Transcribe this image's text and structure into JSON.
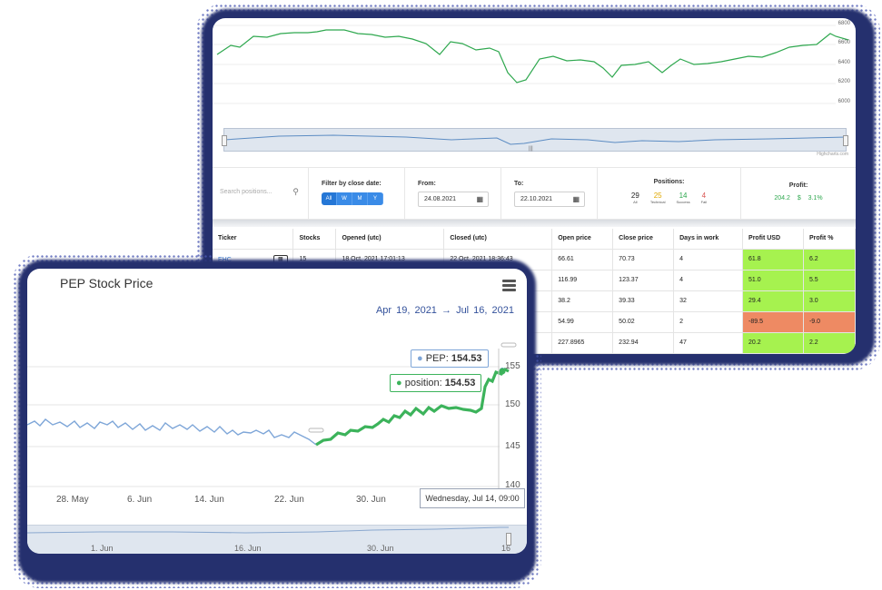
{
  "back_chart": {
    "y_ticks": [
      "6800",
      "6600",
      "6400",
      "6200",
      "6000"
    ],
    "credit": "Highcharts.com",
    "navigator_mid_label": "|||",
    "line_color": "#2fa84f"
  },
  "filters": {
    "search_placeholder": "Search positions...",
    "close_date_label": "Filter by close date:",
    "periods": [
      "All",
      "W",
      "M",
      "Y"
    ],
    "from_label": "From:",
    "from_value": "24.08.2021",
    "to_label": "To:",
    "to_value": "22.10.2021"
  },
  "positions": {
    "title": "Positions:",
    "items": [
      {
        "count": "29",
        "label": "All",
        "color": "#222222"
      },
      {
        "count": "25",
        "label": "Technical",
        "color": "#e0a800"
      },
      {
        "count": "14",
        "label": "Success",
        "color": "#2fa84f"
      },
      {
        "count": "4",
        "label": "Fail",
        "color": "#d9534f"
      }
    ]
  },
  "profit": {
    "title": "Profit:",
    "usd": "204.2 $",
    "pct": "3.1%"
  },
  "table": {
    "headers": [
      "Ticker",
      "Stocks",
      "Opened (utc)",
      "Closed (utc)",
      "Open price",
      "Close price",
      "Days in work",
      "Profit USD",
      "Profit %"
    ],
    "rows": [
      {
        "ticker": "EHC",
        "stocks": "15",
        "opened": "18 Oct, 2021 17:01:13",
        "closed": "22 Oct, 2021 18:36:43",
        "open": "66.61",
        "close": "70.73",
        "days": "4",
        "usd": "61.8",
        "pct": "6.2",
        "status": "g"
      },
      {
        "ticker": "",
        "stocks": "",
        "opened": "",
        "closed": "",
        "open": "116.99",
        "close": "123.37",
        "days": "4",
        "usd": "51.0",
        "pct": "5.5",
        "status": "g"
      },
      {
        "ticker": "",
        "stocks": "",
        "opened": "",
        "closed": "",
        "open": "38.2",
        "close": "39.33",
        "days": "32",
        "usd": "29.4",
        "pct": "3.0",
        "status": "g"
      },
      {
        "ticker": "",
        "stocks": "",
        "opened": "",
        "closed": "",
        "open": "54.99",
        "close": "50.02",
        "days": "2",
        "usd": "-89.5",
        "pct": "-9.0",
        "status": "r"
      },
      {
        "ticker": "",
        "stocks": "",
        "opened": "",
        "closed": "",
        "open": "227.8965",
        "close": "232.94",
        "days": "47",
        "usd": "20.2",
        "pct": "2.2",
        "status": "g"
      }
    ],
    "colors": {
      "profit": "#a6f24f",
      "loss": "#ee8a63"
    }
  },
  "stock_chart": {
    "title": "PEP Stock Price",
    "range_from": "Apr 19, 2021",
    "range_arrow": "→",
    "range_to": "Jul 16, 2021",
    "x_ticks": [
      "28. May",
      "6. Jun",
      "14. Jun",
      "22. Jun",
      "30. Jun"
    ],
    "y_ticks": [
      "155",
      "150",
      "145",
      "140"
    ],
    "nav_ticks": [
      "1. Jun",
      "16. Jun",
      "30. Jun",
      "16"
    ],
    "tooltip_pep_label": "PEP:",
    "tooltip_pep_value": "154.53",
    "tooltip_position_label": "position:",
    "tooltip_position_value": "154.53",
    "crosshair_date": "Wednesday, Jul 14, 09:00",
    "colors": {
      "pep": "#7ea6d8",
      "position": "#3cb35b"
    }
  }
}
